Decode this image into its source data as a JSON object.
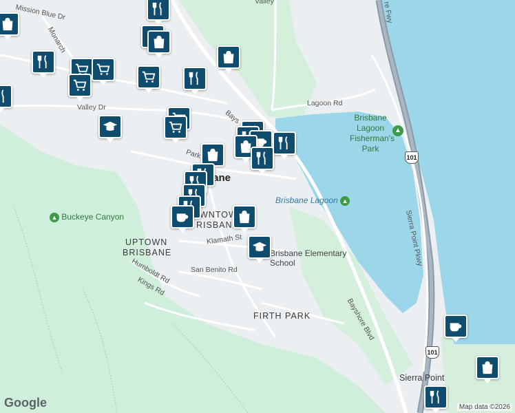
{
  "map": {
    "colors": {
      "water": "#9cd7e9",
      "park": "#c7ebcf",
      "land": "#eceff1",
      "road": "#ffffff",
      "highway": "#9aa7b4",
      "marker": "#0f4c6e"
    },
    "labels": {
      "valley": "Valley",
      "mission_blue": "Mission Blue Dr",
      "monarch": "Monarch",
      "valley_dr": "Valley Dr",
      "lagoon_rd": "Lagoon Rd",
      "bayshore_top": "Bays",
      "parkway": "Park",
      "town": "bane",
      "downtown": "WNTOW",
      "downtown2": "RISBANE",
      "uptown": "UPTOWN",
      "uptown2": "BRISBANE",
      "klamath": "Klamath St",
      "san_benito": "San Benito Rd",
      "humboldt": "Humboldt Rd",
      "kings": "Kings Rd",
      "buckeye": "Buckeye Canyon",
      "brisbane_lagoon_water": "Brisbane Lagoon",
      "lagoon_park": "Brisbane Lagoon Fisherman's Park",
      "school": "Brisbane Elementary School",
      "firth_park": "FIRTH PARK",
      "bayshore_blvd": "Bayshore Blvd",
      "sierra_point_pkwy": "Sierra Point Pkwy",
      "sierra_point": "Sierra Point",
      "fwy": "re Fwy",
      "shield_101": "101"
    },
    "google_logo": "Google",
    "attribution": "Map data ©2026"
  }
}
